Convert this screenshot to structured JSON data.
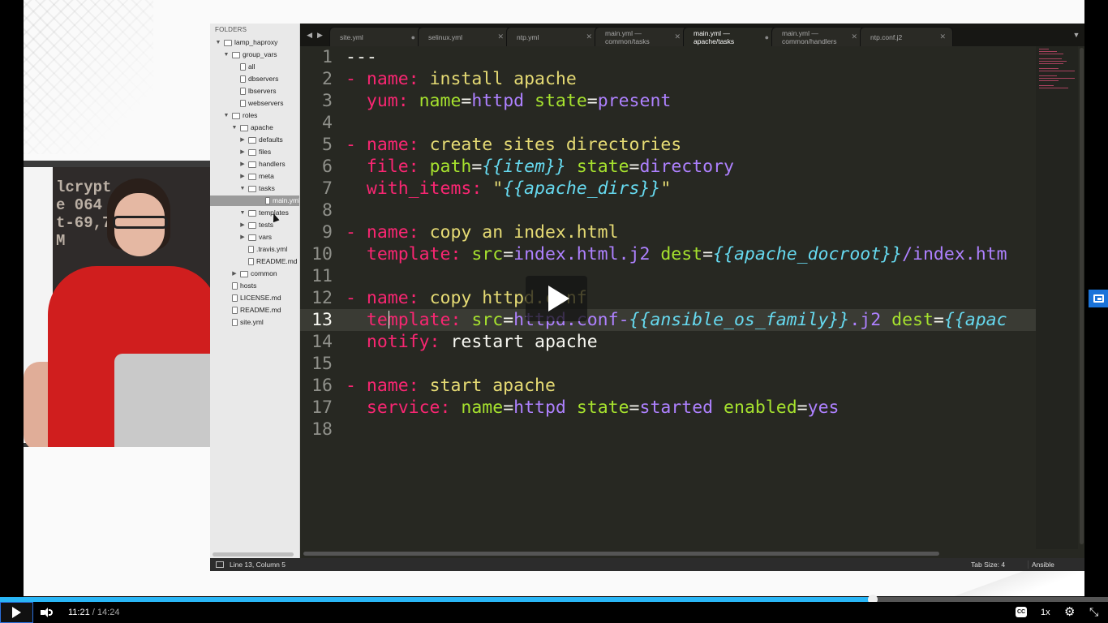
{
  "sidebar": {
    "header": "FOLDERS",
    "items": [
      {
        "label": "lamp_haproxy",
        "type": "folder",
        "open": true,
        "depth": 0
      },
      {
        "label": "group_vars",
        "type": "folder",
        "open": true,
        "depth": 1
      },
      {
        "label": "all",
        "type": "file",
        "depth": 2
      },
      {
        "label": "dbservers",
        "type": "file",
        "depth": 2
      },
      {
        "label": "lbservers",
        "type": "file",
        "depth": 2
      },
      {
        "label": "webservers",
        "type": "file",
        "depth": 2
      },
      {
        "label": "roles",
        "type": "folder",
        "open": true,
        "depth": 1
      },
      {
        "label": "apache",
        "type": "folder",
        "open": true,
        "depth": 2
      },
      {
        "label": "defaults",
        "type": "folder",
        "open": false,
        "depth": 3
      },
      {
        "label": "files",
        "type": "folder",
        "open": false,
        "depth": 3
      },
      {
        "label": "handlers",
        "type": "folder",
        "open": false,
        "depth": 3
      },
      {
        "label": "meta",
        "type": "folder",
        "open": false,
        "depth": 3
      },
      {
        "label": "tasks",
        "type": "folder",
        "open": true,
        "depth": 3
      },
      {
        "label": "main.yml",
        "type": "file",
        "depth": 4,
        "selected": true
      },
      {
        "label": "templates",
        "type": "folder",
        "open": true,
        "depth": 3
      },
      {
        "label": "tests",
        "type": "folder",
        "open": false,
        "depth": 3
      },
      {
        "label": "vars",
        "type": "folder",
        "open": false,
        "depth": 3
      },
      {
        "label": ".travis.yml",
        "type": "file",
        "depth": 3
      },
      {
        "label": "README.md",
        "type": "file",
        "depth": 3
      },
      {
        "label": "common",
        "type": "folder",
        "open": false,
        "depth": 2
      },
      {
        "label": "hosts",
        "type": "file",
        "depth": 1
      },
      {
        "label": "LICENSE.md",
        "type": "file",
        "depth": 1
      },
      {
        "label": "README.md",
        "type": "file",
        "depth": 1
      },
      {
        "label": "site.yml",
        "type": "file",
        "depth": 1
      }
    ]
  },
  "tabs": [
    {
      "label": "site.yml",
      "indicator": "dot"
    },
    {
      "label": "selinux.yml",
      "indicator": "close"
    },
    {
      "label": "ntp.yml",
      "indicator": "close"
    },
    {
      "label": "main.yml — common/tasks",
      "indicator": "close"
    },
    {
      "label": "main.yml — apache/tasks",
      "indicator": "dot",
      "active": true
    },
    {
      "label": "main.yml — common/handlers",
      "indicator": "close"
    },
    {
      "label": "ntp.conf.j2",
      "indicator": "close"
    }
  ],
  "code": [
    {
      "n": "1",
      "tokens": [
        [
          "plain",
          "---"
        ]
      ]
    },
    {
      "n": "2",
      "tokens": [
        [
          "dash",
          "- "
        ],
        [
          "key",
          "name:"
        ],
        [
          "str",
          " install apache"
        ]
      ]
    },
    {
      "n": "3",
      "tokens": [
        [
          "plain",
          "  "
        ],
        [
          "key",
          "yum:"
        ],
        [
          "attr",
          " name"
        ],
        [
          "plain",
          "="
        ],
        [
          "val",
          "httpd"
        ],
        [
          "attr",
          " state"
        ],
        [
          "plain",
          "="
        ],
        [
          "val",
          "present"
        ]
      ]
    },
    {
      "n": "4",
      "tokens": []
    },
    {
      "n": "5",
      "tokens": [
        [
          "dash",
          "- "
        ],
        [
          "key",
          "name:"
        ],
        [
          "str",
          " create sites directories"
        ]
      ]
    },
    {
      "n": "6",
      "tokens": [
        [
          "plain",
          "  "
        ],
        [
          "key",
          "file:"
        ],
        [
          "attr",
          " path"
        ],
        [
          "plain",
          "="
        ],
        [
          "tpl",
          "{{item}}"
        ],
        [
          "attr",
          " state"
        ],
        [
          "plain",
          "="
        ],
        [
          "val",
          "directory"
        ]
      ]
    },
    {
      "n": "7",
      "tokens": [
        [
          "plain",
          "  "
        ],
        [
          "key",
          "with_items:"
        ],
        [
          "str",
          " \""
        ],
        [
          "tpl",
          "{{apache_dirs}}"
        ],
        [
          "str",
          "\""
        ]
      ]
    },
    {
      "n": "8",
      "tokens": []
    },
    {
      "n": "9",
      "tokens": [
        [
          "dash",
          "- "
        ],
        [
          "key",
          "name:"
        ],
        [
          "str",
          " copy an index.html"
        ]
      ]
    },
    {
      "n": "10",
      "tokens": [
        [
          "plain",
          "  "
        ],
        [
          "key",
          "template:"
        ],
        [
          "attr",
          " src"
        ],
        [
          "plain",
          "="
        ],
        [
          "val",
          "index.html.j2"
        ],
        [
          "attr",
          " dest"
        ],
        [
          "plain",
          "="
        ],
        [
          "tpl",
          "{{apache_docroot}}"
        ],
        [
          "val",
          "/index.htm"
        ]
      ]
    },
    {
      "n": "11",
      "tokens": []
    },
    {
      "n": "12",
      "tokens": [
        [
          "dash",
          "- "
        ],
        [
          "key",
          "name:"
        ],
        [
          "str",
          " copy httpd.conf"
        ]
      ]
    },
    {
      "n": "13",
      "tokens": [
        [
          "plain",
          "  "
        ],
        [
          "key",
          "template:"
        ],
        [
          "attr",
          " src"
        ],
        [
          "plain",
          "="
        ],
        [
          "val",
          "httpd.conf-"
        ],
        [
          "tpl",
          "{{ansible_os_family}}"
        ],
        [
          "val",
          ".j2"
        ],
        [
          "attr",
          " dest"
        ],
        [
          "plain",
          "="
        ],
        [
          "tpl",
          "{{apac"
        ]
      ],
      "current": true
    },
    {
      "n": "14",
      "tokens": [
        [
          "plain",
          "  "
        ],
        [
          "key",
          "notify:"
        ],
        [
          "plain",
          " restart apache"
        ]
      ]
    },
    {
      "n": "15",
      "tokens": []
    },
    {
      "n": "16",
      "tokens": [
        [
          "dash",
          "- "
        ],
        [
          "key",
          "name:"
        ],
        [
          "str",
          " start apache"
        ]
      ]
    },
    {
      "n": "17",
      "tokens": [
        [
          "plain",
          "  "
        ],
        [
          "key",
          "service:"
        ],
        [
          "attr",
          " name"
        ],
        [
          "plain",
          "="
        ],
        [
          "val",
          "httpd"
        ],
        [
          "attr",
          " state"
        ],
        [
          "plain",
          "="
        ],
        [
          "val",
          "started"
        ],
        [
          "attr",
          " enabled"
        ],
        [
          "plain",
          "="
        ],
        [
          "val",
          "yes"
        ]
      ]
    },
    {
      "n": "18",
      "tokens": []
    }
  ],
  "status": {
    "position": "Line 13, Column 5",
    "tab_size": "Tab Size: 4",
    "syntax": "Ansible"
  },
  "webcam": {
    "board_text": "lcrypt\ne 064\nt-69,7\nM"
  },
  "player": {
    "current_time": "11:21",
    "separator": "/",
    "duration": "14:24",
    "progress": 0.7876,
    "cc_label": "CC",
    "speed": "1x",
    "settings_icon": "gear-icon",
    "fullscreen_icon": "fullscreen-exit-icon"
  },
  "colors": {
    "editor_bg": "#272822",
    "keyword": "#f92672",
    "string": "#e6db74",
    "attr": "#a6e22e",
    "value": "#ae81ff",
    "template": "#66d9ef",
    "progress_fill": "#29b6f6"
  }
}
